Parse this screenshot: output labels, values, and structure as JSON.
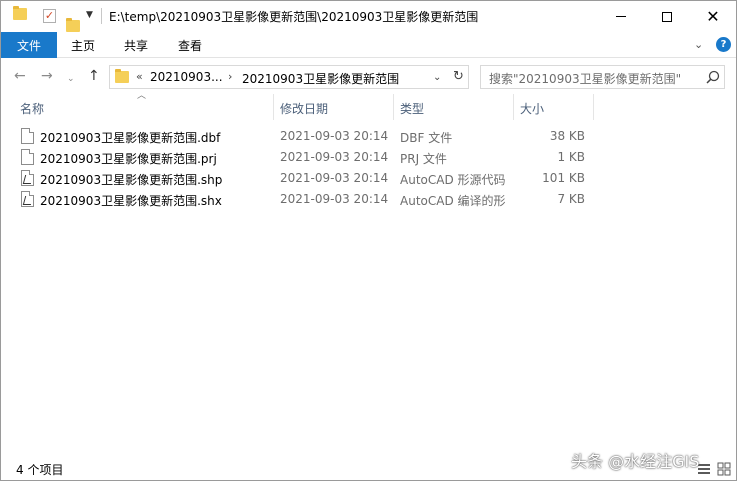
{
  "window": {
    "title": "E:\\temp\\20210903卫星影像更新范围\\20210903卫星影像更新范围",
    "controls": {
      "minimize": "—",
      "maximize": "☐",
      "close": "✕"
    }
  },
  "ribbon": {
    "tabs": [
      "文件",
      "主页",
      "共享",
      "查看"
    ],
    "help": "?"
  },
  "address": {
    "crumbs": [
      "«",
      "20210903...",
      "›",
      "20210903卫星影像更新范围"
    ]
  },
  "search": {
    "placeholder": "搜索\"20210903卫星影像更新范围\""
  },
  "columns": [
    "名称",
    "修改日期",
    "类型",
    "大小"
  ],
  "files": [
    {
      "name": "20210903卫星影像更新范围.dbf",
      "date": "2021-09-03 20:14",
      "type": "DBF 文件",
      "size": "38 KB",
      "icon": "document-icon"
    },
    {
      "name": "20210903卫星影像更新范围.prj",
      "date": "2021-09-03 20:14",
      "type": "PRJ 文件",
      "size": "1 KB",
      "icon": "document-icon"
    },
    {
      "name": "20210903卫星影像更新范围.shp",
      "date": "2021-09-03 20:14",
      "type": "AutoCAD 形源代码",
      "size": "101 KB",
      "icon": "autocad-shape-icon"
    },
    {
      "name": "20210903卫星影像更新范围.shx",
      "date": "2021-09-03 20:14",
      "type": "AutoCAD 编译的形",
      "size": "7 KB",
      "icon": "autocad-shape-icon"
    }
  ],
  "status": {
    "item_count": "4 个项目"
  },
  "watermark": "头条 @水经注GIS",
  "colors": {
    "accent": "#1979ca",
    "folder": "#f5cf58",
    "header_text": "#4c607a"
  }
}
